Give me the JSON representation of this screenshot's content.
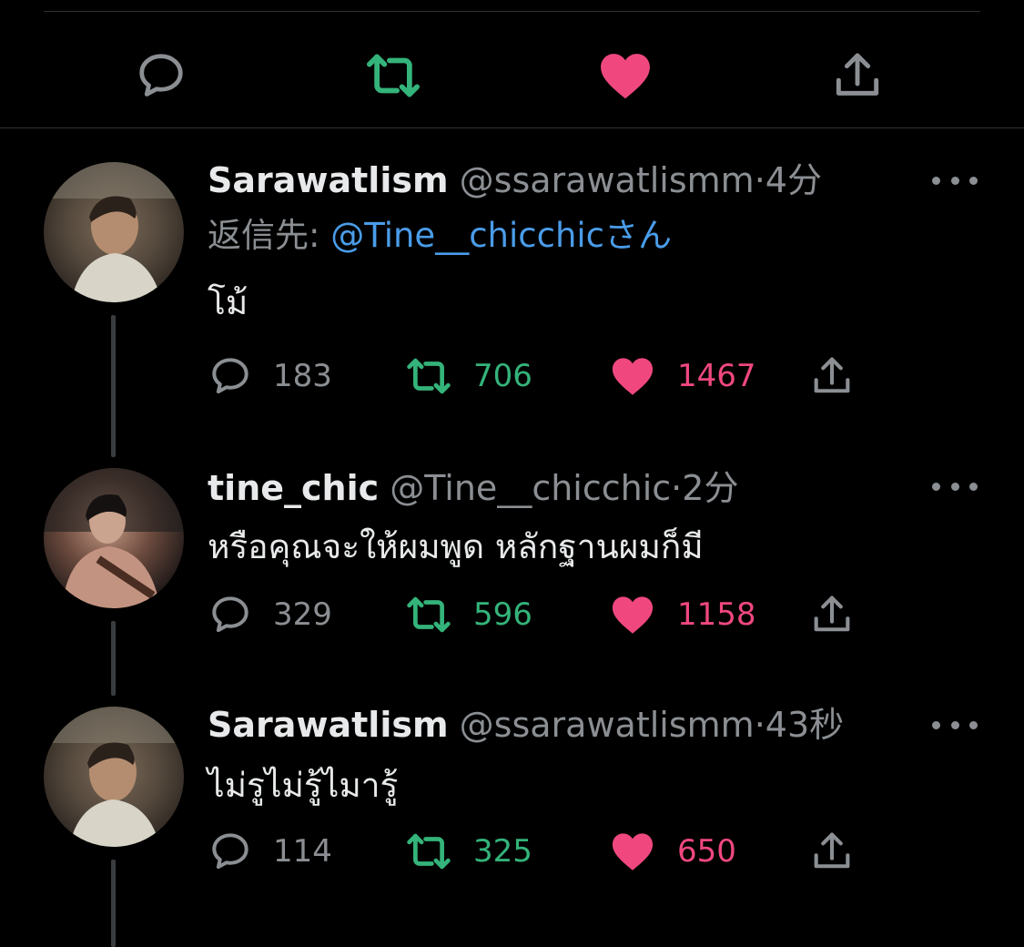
{
  "action_bar": {
    "icons": [
      "reply-icon",
      "retweet-icon",
      "like-icon",
      "share-icon"
    ],
    "colors": {
      "reply": "#8b8f93",
      "retweet": "#34b37a",
      "like": "#f0487e",
      "share": "#8b8f93"
    }
  },
  "tweets": [
    {
      "name": "Sarawatlism",
      "handle": "@ssarawatlismm",
      "dot": "·",
      "time": "4分",
      "reply_prefix": "返信先: ",
      "reply_mention": "@Tine__chicchic",
      "reply_suffix": "さん",
      "text": "โม้",
      "replies": "183",
      "retweets": "706",
      "likes": "1467"
    },
    {
      "name": "tine_chic",
      "handle": "@Tine__chicchic",
      "dot": "·",
      "time": "2分",
      "text": "หรือคุณจะให้ผมพูด หลักฐานผมก็มี",
      "replies": "329",
      "retweets": "596",
      "likes": "1158"
    },
    {
      "name": "Sarawatlism",
      "handle": "@ssarawatlismm",
      "dot": "·",
      "time": "43秒",
      "text": "ไม่รูไม่รู้ไมารู้",
      "replies": "114",
      "retweets": "325",
      "likes": "650"
    }
  ]
}
